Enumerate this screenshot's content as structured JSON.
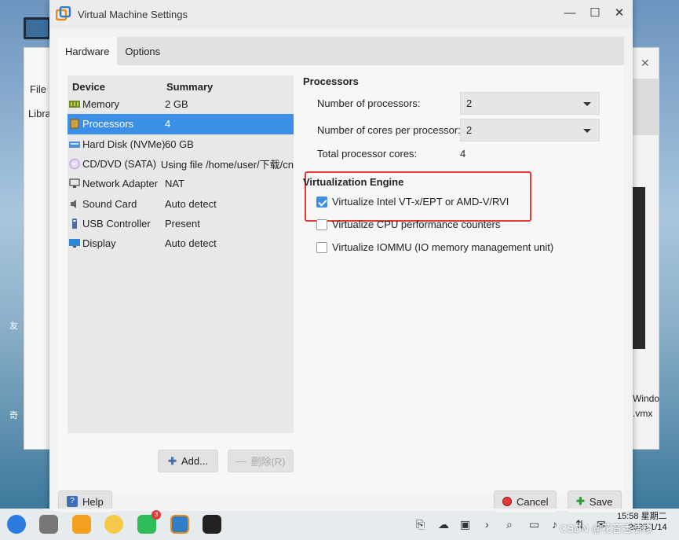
{
  "background": {
    "menu_file": "File",
    "library_label": "Libra",
    "right_text_1": "Windo",
    "right_text_2": ".vmx",
    "left_text_1": "友",
    "left_text_2": "奇"
  },
  "dialog": {
    "title": "Virtual Machine Settings",
    "tabs": [
      {
        "label": "Hardware",
        "active": true
      },
      {
        "label": "Options",
        "active": false
      }
    ],
    "device_list": {
      "col_device": "Device",
      "col_summary": "Summary",
      "rows": [
        {
          "device": "Memory",
          "summary": "2 GB",
          "icon": "memory-icon",
          "selected": false
        },
        {
          "device": "Processors",
          "summary": "4",
          "icon": "processor-icon",
          "selected": true
        },
        {
          "device": "Hard Disk (NVMe)",
          "summary": "60 GB",
          "icon": "hard-disk-icon",
          "selected": false
        },
        {
          "device": "CD/DVD (SATA)",
          "summary": "Using file /home/user/下载/cn",
          "icon": "cd-dvd-icon",
          "selected": false
        },
        {
          "device": "Network Adapter",
          "summary": "NAT",
          "icon": "network-adapter-icon",
          "selected": false
        },
        {
          "device": "Sound Card",
          "summary": "Auto detect",
          "icon": "sound-card-icon",
          "selected": false
        },
        {
          "device": "USB Controller",
          "summary": "Present",
          "icon": "usb-icon",
          "selected": false
        },
        {
          "device": "Display",
          "summary": "Auto detect",
          "icon": "display-icon",
          "selected": false
        }
      ]
    },
    "add_button": "Add...",
    "remove_button": "删除(R)",
    "processors": {
      "heading": "Processors",
      "num_processors_label": "Number of processors:",
      "num_processors_value": "2",
      "cores_label": "Number of cores per processor:",
      "cores_value": "2",
      "total_label": "Total processor cores:",
      "total_value": "4"
    },
    "virtualization": {
      "heading": "Virtualization Engine",
      "options": [
        {
          "label": "Virtualize Intel VT-x/EPT or AMD-V/RVI",
          "checked": true
        },
        {
          "label": "Virtualize CPU performance counters",
          "checked": false
        },
        {
          "label": "Virtualize IOMMU (IO memory management unit)",
          "checked": false
        }
      ]
    },
    "help_button": "Help",
    "cancel_button": "Cancel",
    "save_button": "Save"
  },
  "taskbar": {
    "badge_count": "3",
    "time": "15:58 星期二",
    "date": "2025/1/14"
  },
  "watermark": "CSDN @花音香洁楼",
  "colors": {
    "accent": "#3c8fe6",
    "highlight_border": "#e53935"
  }
}
